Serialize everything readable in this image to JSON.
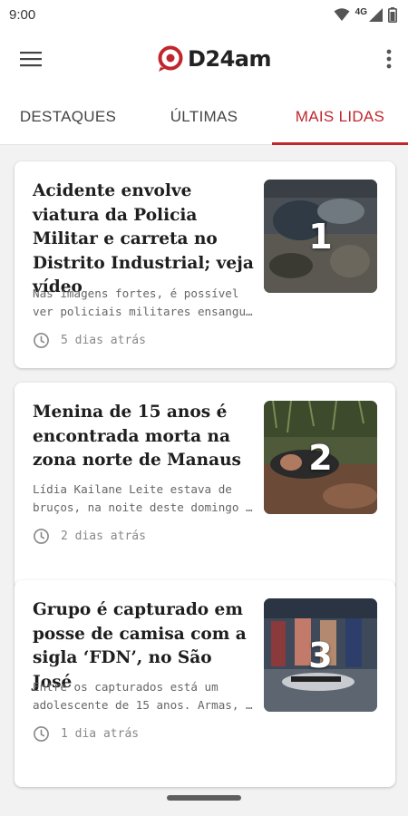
{
  "status_bar": {
    "time": "9:00",
    "network": "4G"
  },
  "app": {
    "logo_text": "D24am"
  },
  "tabs": [
    {
      "label": "DESTAQUES",
      "active": false
    },
    {
      "label": "ÚLTIMAS",
      "active": false
    },
    {
      "label": "MAIS LIDAS",
      "active": true
    }
  ],
  "articles": [
    {
      "rank": "1",
      "title": "Acidente envolve viatura da Policia Militar e carreta no Distrito Industrial; veja vídeo",
      "summary": "Nas imagens fortes, é possível\nver policiais militares ensangu…",
      "time": "5 dias atrás"
    },
    {
      "rank": "2",
      "title": "Menina de 15 anos é encontrada morta na zona norte de Manaus",
      "summary": "Lídia Kailane Leite estava de\nbruços, na noite deste domingo …",
      "time": "2 dias atrás"
    },
    {
      "rank": "3",
      "title": "Grupo é capturado em posse de camisa com a sigla ‘FDN’, no São José",
      "summary": "Entre os capturados está um\nadolescente de 15 anos. Armas, …",
      "time": "1 dia atrás"
    }
  ],
  "colors": {
    "accent": "#c0272d",
    "background": "#f2f2f2"
  }
}
